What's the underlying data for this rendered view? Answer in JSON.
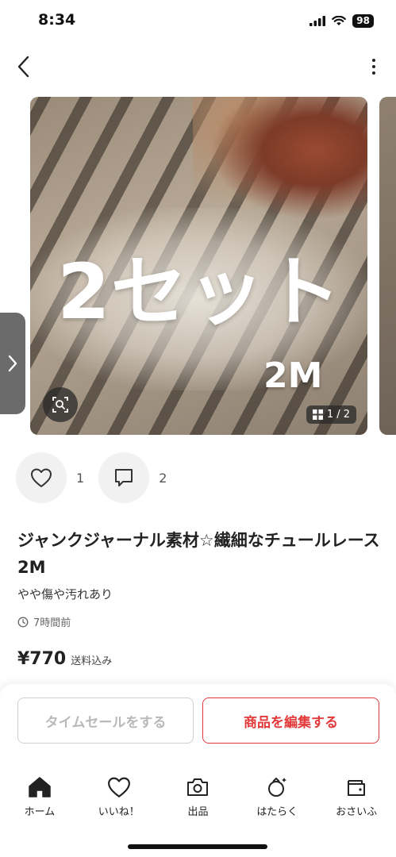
{
  "status_bar": {
    "time": "8:34",
    "battery": "98",
    "icons": [
      "signal-icon",
      "wifi-icon",
      "battery-icon"
    ]
  },
  "nav": {
    "back_icon": "chevron-left-icon",
    "more_icon": "more-vertical-icon"
  },
  "gallery": {
    "overlay_text": "2セット",
    "overlay_sub": "2M",
    "counter": "1 / 2",
    "zoom_icon": "zoom-icon",
    "side_handle_icon": "chevron-right-icon"
  },
  "actions": {
    "like_count": "1",
    "comment_count": "2"
  },
  "item": {
    "title": "ジャンクジャーナル素材☆繊細なチュールレース 2M",
    "condition": "やや傷や汚れあり",
    "posted": "7時間前",
    "price": "¥770",
    "shipping": "送料込み"
  },
  "buttons": {
    "timesale": "タイムセールをする",
    "edit": "商品を編集する"
  },
  "tabbar": [
    {
      "label": "ホーム",
      "icon": "home-icon"
    },
    {
      "label": "いいね！",
      "icon": "heart-icon"
    },
    {
      "label": "出品",
      "icon": "camera-icon"
    },
    {
      "label": "はたらく",
      "icon": "work-icon"
    },
    {
      "label": "おさいふ",
      "icon": "wallet-icon"
    }
  ],
  "colors": {
    "accent": "#e23a3a",
    "disabled_text": "#b9b9b9"
  }
}
